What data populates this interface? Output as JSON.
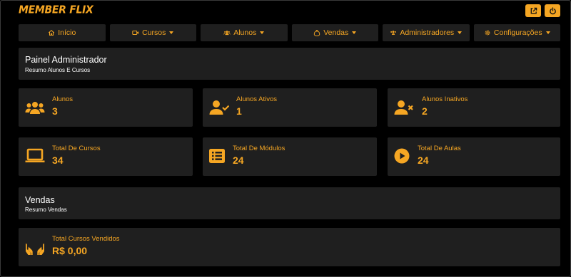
{
  "brand": {
    "logo": "MEMBER FLIX",
    "accent": "#f5a623"
  },
  "topbar": {
    "buttons": [
      {
        "name": "external-link-icon"
      },
      {
        "name": "power-icon"
      }
    ]
  },
  "nav": {
    "items": [
      {
        "label": "Início",
        "icon": "home-icon",
        "dropdown": false
      },
      {
        "label": "Cursos",
        "icon": "video-icon",
        "dropdown": true
      },
      {
        "label": "Alunos",
        "icon": "users-icon",
        "dropdown": true
      },
      {
        "label": "Vendas",
        "icon": "money-bag-icon",
        "dropdown": true
      },
      {
        "label": "Administradores",
        "icon": "users-cog-icon",
        "dropdown": true
      },
      {
        "label": "Configurações",
        "icon": "gear-icon",
        "dropdown": true
      }
    ]
  },
  "admin_panel": {
    "title": "Painel Administrador",
    "subtitle": "Resumo Alunos E Cursos"
  },
  "stats": {
    "alunos": {
      "label": "Alunos",
      "value": "3",
      "icon": "users-icon"
    },
    "alunos_ativos": {
      "label": "Alunos Ativos",
      "value": "1",
      "icon": "user-check-icon"
    },
    "alunos_inativos": {
      "label": "Alunos Inativos",
      "value": "2",
      "icon": "user-times-icon"
    },
    "total_cursos": {
      "label": "Total De Cursos",
      "value": "34",
      "icon": "laptop-icon"
    },
    "total_modulos": {
      "label": "Total De Módulos",
      "value": "24",
      "icon": "list-icon"
    },
    "total_aulas": {
      "label": "Total De Aulas",
      "value": "24",
      "icon": "play-circle-icon"
    }
  },
  "sales_panel": {
    "title": "Vendas",
    "subtitle": "Resumo Vendas"
  },
  "sales": {
    "total_vendidos": {
      "label": "Total Cursos Vendidos",
      "value": "R$ 0,00",
      "icon": "hands-icon"
    }
  }
}
